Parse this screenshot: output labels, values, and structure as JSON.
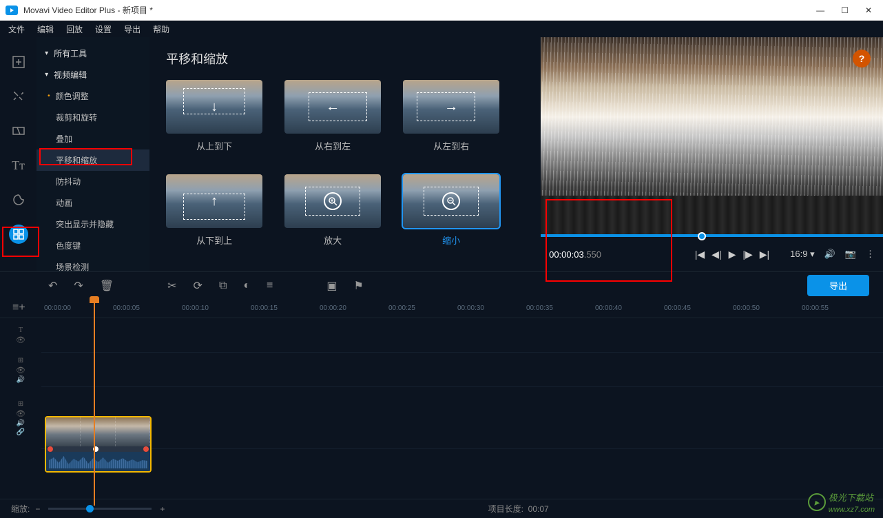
{
  "titlebar": {
    "app": "Movavi Video Editor Plus",
    "project": "新项目 *"
  },
  "menubar": [
    "文件",
    "编辑",
    "回放",
    "设置",
    "导出",
    "帮助"
  ],
  "rail_icons": [
    "add-media-icon",
    "magic-wand-icon",
    "transitions-icon",
    "titles-icon",
    "stickers-icon",
    "more-tools-icon"
  ],
  "sidebar": {
    "items": [
      {
        "label": "所有工具",
        "type": "header"
      },
      {
        "label": "视频编辑",
        "type": "header"
      },
      {
        "label": "颜色调整",
        "type": "bullet"
      },
      {
        "label": "裁剪和旋转"
      },
      {
        "label": "叠加"
      },
      {
        "label": "平移和缩放",
        "active": true
      },
      {
        "label": "防抖动"
      },
      {
        "label": "动画"
      },
      {
        "label": "突出显示并隐藏"
      },
      {
        "label": "色度键"
      },
      {
        "label": "场景检测"
      }
    ]
  },
  "effects": {
    "title": "平移和缩放",
    "cards": [
      {
        "label": "从上到下",
        "icon": "↓"
      },
      {
        "label": "从右到左",
        "icon": "←"
      },
      {
        "label": "从左到右",
        "icon": "→"
      },
      {
        "label": "从下到上",
        "icon": "↑"
      },
      {
        "label": "放大",
        "icon": "+"
      },
      {
        "label": "缩小",
        "icon": "−",
        "selected": true
      }
    ]
  },
  "preview": {
    "time_active": "00:00:03",
    "time_rest": ".550",
    "aspect": "16:9",
    "help": "?"
  },
  "toolbar": {
    "export": "导出",
    "tools": [
      "undo",
      "redo",
      "delete",
      "",
      "cut",
      "rotate",
      "crop",
      "color",
      "adjust",
      "",
      "record",
      "marker"
    ]
  },
  "timeline": {
    "ruler": [
      "00:00:00",
      "00:00:05",
      "00:00:10",
      "00:00:15",
      "00:00:20",
      "00:00:25",
      "00:00:30",
      "00:00:35",
      "00:00:40",
      "00:00:45",
      "00:00:50",
      "00:00:55"
    ]
  },
  "bottom": {
    "zoom_label": "缩放:",
    "duration_label": "项目长度:",
    "duration": "00:07"
  },
  "watermark": {
    "text": "极光下载站",
    "url": "www.xz7.com"
  }
}
